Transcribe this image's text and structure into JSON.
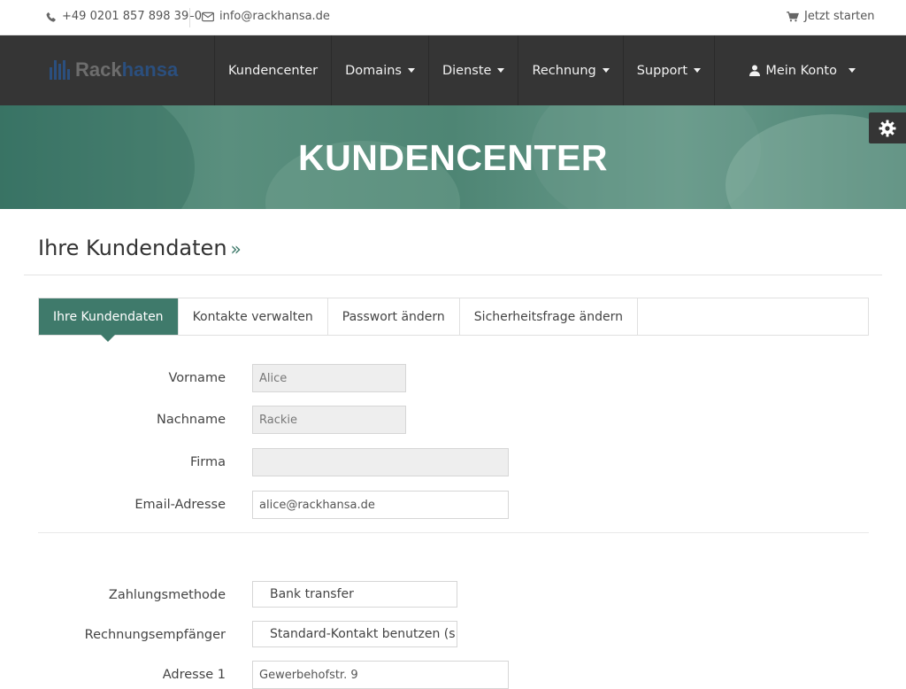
{
  "topbar": {
    "phone": "+49 0201 857 898 39–0",
    "email": "info@rackhansa.de",
    "start_label": "Jetzt starten"
  },
  "brand": {
    "part1": "Rack",
    "part2": "hansa"
  },
  "nav": {
    "items": [
      {
        "label": "Kundencenter",
        "dropdown": false
      },
      {
        "label": "Domains",
        "dropdown": true
      },
      {
        "label": "Dienste",
        "dropdown": true
      },
      {
        "label": "Rechnung",
        "dropdown": true
      },
      {
        "label": "Support",
        "dropdown": true
      }
    ],
    "account_label": "Mein Konto"
  },
  "banner": {
    "title": "KUNDENCENTER"
  },
  "page": {
    "title": "Ihre Kundendaten",
    "title_suffix": "»"
  },
  "tabs": [
    {
      "label": "Ihre Kundendaten",
      "active": true
    },
    {
      "label": "Kontakte verwalten",
      "active": false
    },
    {
      "label": "Passwort ändern",
      "active": false
    },
    {
      "label": "Sicherheitsfrage ändern",
      "active": false
    }
  ],
  "form": {
    "firstname": {
      "label": "Vorname",
      "value": "Alice"
    },
    "lastname": {
      "label": "Nachname",
      "value": "Rackie"
    },
    "company": {
      "label": "Firma",
      "value": ""
    },
    "email": {
      "label": "Email-Adresse",
      "value": "alice@rackhansa.de"
    },
    "payment": {
      "label": "Zahlungsmethode",
      "value": "Bank transfer"
    },
    "billing_contact": {
      "label": "Rechnungsempfänger",
      "value": "Standard-Kontakt benutzen (s"
    },
    "address1": {
      "label": "Adresse 1",
      "value": "Gewerbehofstr. 9"
    }
  },
  "colors": {
    "accent": "#3f7a6b",
    "navbar": "#353535",
    "brand_blue": "#2b4f7e"
  },
  "icons": {
    "phone": "phone-icon",
    "email": "envelope-icon",
    "cart": "cart-icon",
    "user": "user-icon",
    "settings": "gear-icon"
  }
}
